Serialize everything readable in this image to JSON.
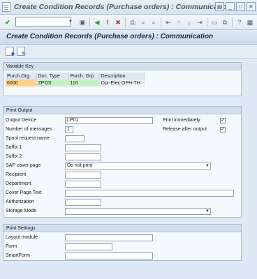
{
  "window": {
    "title": "Create Condition Records (Purchase orders) : Communication"
  },
  "toolbar": {
    "icons": [
      "enter-icon",
      "save-icon",
      "back-icon",
      "exit-icon",
      "cancel-icon",
      "print-icon",
      "find-icon",
      "find-next-icon",
      "first-page-icon",
      "previous-page-icon",
      "next-page-icon",
      "last-page-icon",
      "new-session-icon",
      "shortcut-icon",
      "help-icon",
      "customize-icon"
    ]
  },
  "header": {
    "title": "Create Condition Records (Purchase orders) : Communication"
  },
  "variable_key": {
    "title": "Variable Key",
    "columns": [
      "Purch.Org.",
      "Doc. Type",
      "Purch. Grp",
      "Description"
    ],
    "row": [
      "6000",
      "ZPOS",
      "116",
      "Opr-Elec OPH-TH"
    ]
  },
  "print_output": {
    "title": "Print Output",
    "output_device_label": "Output Device",
    "output_device_value": "LP01",
    "num_messages_label": "Number of messages",
    "num_messages_value": "1",
    "spool_label": "Spool request name",
    "suffix1_label": "Suffix 1",
    "suffix2_label": "Suffix 2",
    "cover_page_label": "SAP cover page",
    "cover_page_value": "Do not print",
    "recipient_label": "Recipient",
    "department_label": "Department",
    "cover_text_label": "Cover Page Text",
    "authorization_label": "Authorization",
    "storage_mode_label": "Storage Mode",
    "print_immediately_label": "Print immediately",
    "release_after_output_label": "Release after output",
    "print_immediately_checked": true,
    "release_after_output_checked": true
  },
  "print_settings": {
    "title": "Print Settings",
    "layout_module_label": "Layout module",
    "form_label": "Form",
    "smartform_label": "SmartForm"
  }
}
